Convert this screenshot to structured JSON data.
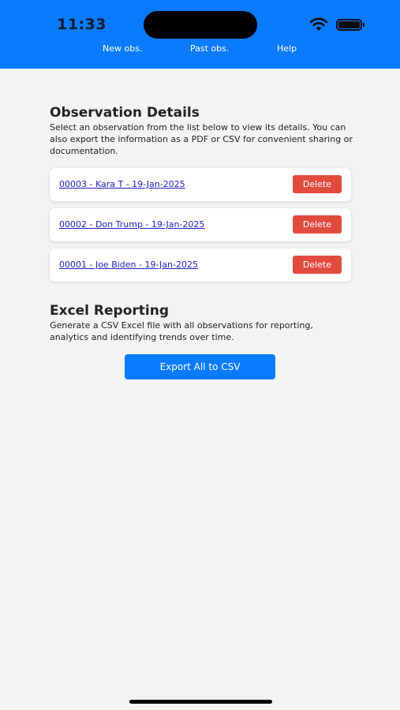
{
  "status_bar": {
    "time": "11:33",
    "icons": [
      "wifi-icon",
      "battery-icon"
    ]
  },
  "nav": {
    "items": [
      {
        "label": "New obs."
      },
      {
        "label": "Past obs."
      },
      {
        "label": "Help"
      }
    ]
  },
  "details": {
    "title": "Observation Details",
    "description": "Select an observation from the list below to view its details. You can also export the information as a PDF or CSV for convenient sharing or documentation."
  },
  "observations": [
    {
      "link": "00003 - Kara T - 19-Jan-2025",
      "delete_label": "Delete"
    },
    {
      "link": "00002 - Don Trump - 19-Jan-2025",
      "delete_label": "Delete"
    },
    {
      "link": "00001 - Joe Biden - 19-Jan-2025",
      "delete_label": "Delete"
    }
  ],
  "excel": {
    "title": "Excel Reporting",
    "description": "Generate a CSV Excel file with all observations for reporting, analytics and identifying trends over time.",
    "export_label": "Export All to CSV"
  },
  "colors": {
    "header": "#0a7bff",
    "delete": "#e14b3d",
    "link": "#1f1fbf",
    "background": "#f3f3f3"
  }
}
